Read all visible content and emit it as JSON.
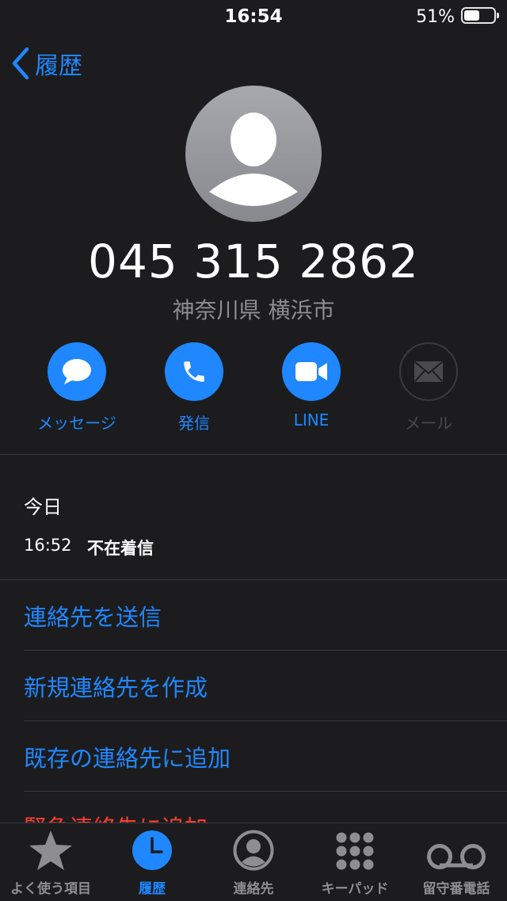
{
  "status_bar": {
    "time": "16:54",
    "battery": "51%",
    "battery_level": 0.51
  },
  "nav": {
    "back_label": "履歴"
  },
  "contact": {
    "number": "045 315 2862",
    "region": "神奈川県 横浜市"
  },
  "actions": [
    {
      "label": "メッセージ",
      "icon": "message-icon",
      "enabled": true
    },
    {
      "label": "発信",
      "icon": "phone-icon",
      "enabled": true
    },
    {
      "label": "LINE",
      "icon": "video-icon",
      "enabled": true
    },
    {
      "label": "メール",
      "icon": "mail-icon",
      "enabled": false
    }
  ],
  "history": {
    "day": "今日",
    "time": "16:52",
    "status": "不在着信"
  },
  "options": [
    {
      "label": "連絡先を送信"
    },
    {
      "label": "新規連絡先を作成"
    },
    {
      "label": "既存の連絡先に追加"
    },
    {
      "label": "緊急連絡先に追加"
    }
  ],
  "tabs": [
    {
      "label": "よく使う項目",
      "icon": "star-icon"
    },
    {
      "label": "履歴",
      "icon": "clock-icon",
      "active": true
    },
    {
      "label": "連絡先",
      "icon": "person-circle-icon"
    },
    {
      "label": "キーパッド",
      "icon": "keypad-icon"
    },
    {
      "label": "留守番電話",
      "icon": "voicemail-icon"
    }
  ],
  "colors": {
    "accent": "#1f87ff",
    "background": "#1c1c1e",
    "destructive": "#ff3b30",
    "secondary_text": "#8d8d92"
  }
}
